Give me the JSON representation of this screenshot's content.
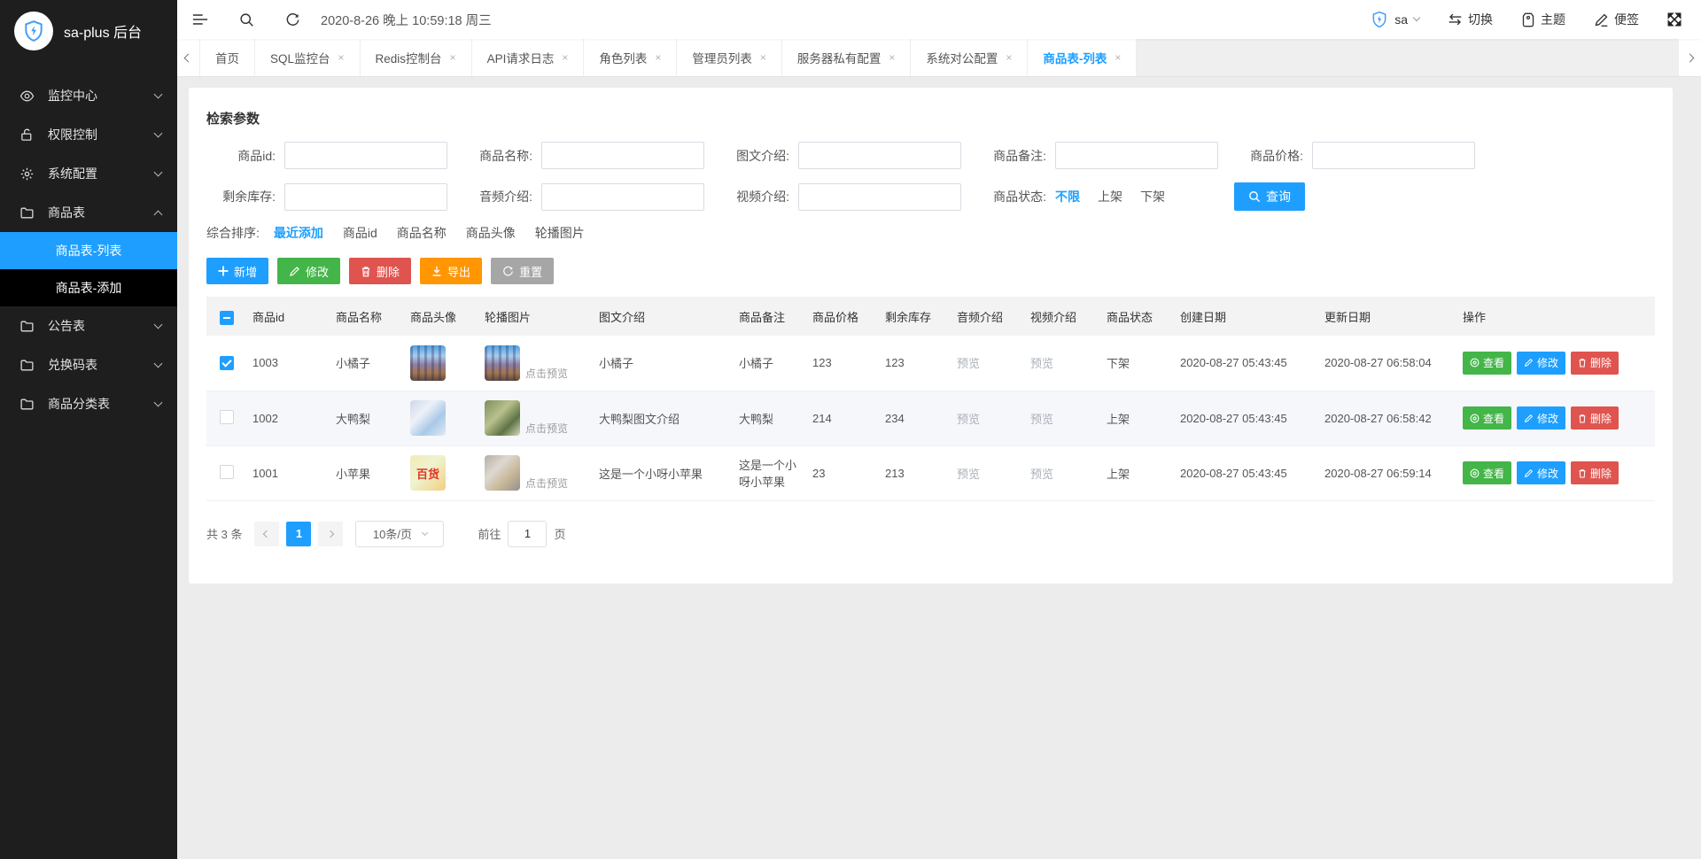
{
  "app_title": "sa-plus 后台",
  "topbar": {
    "time": "2020-8-26 晚上 10:59:18 周三",
    "username": "sa",
    "switch_label": "切换",
    "theme_label": "主题",
    "note_label": "便签"
  },
  "sidebar": {
    "items": [
      {
        "label": "监控中心",
        "icon": "eye-icon"
      },
      {
        "label": "权限控制",
        "icon": "unlock-icon"
      },
      {
        "label": "系统配置",
        "icon": "gear-icon"
      },
      {
        "label": "商品表",
        "icon": "folder-icon"
      },
      {
        "label": "公告表",
        "icon": "folder-icon"
      },
      {
        "label": "兑换码表",
        "icon": "folder-icon"
      },
      {
        "label": "商品分类表",
        "icon": "folder-icon"
      }
    ],
    "sub_items": [
      {
        "label": "商品表-列表",
        "active": true
      },
      {
        "label": "商品表-添加",
        "active": false
      }
    ]
  },
  "tabs": [
    {
      "label": "首页",
      "closable": false
    },
    {
      "label": "SQL监控台",
      "closable": true
    },
    {
      "label": "Redis控制台",
      "closable": true
    },
    {
      "label": "API请求日志",
      "closable": true
    },
    {
      "label": "角色列表",
      "closable": true
    },
    {
      "label": "管理员列表",
      "closable": true
    },
    {
      "label": "服务器私有配置",
      "closable": true
    },
    {
      "label": "系统对公配置",
      "closable": true
    },
    {
      "label": "商品表-列表",
      "closable": true,
      "active": true
    }
  ],
  "search": {
    "title": "检索参数",
    "fields": [
      {
        "label": "商品id:"
      },
      {
        "label": "商品名称:"
      },
      {
        "label": "图文介绍:"
      },
      {
        "label": "商品备注:"
      },
      {
        "label": "商品价格:"
      },
      {
        "label": "剩余库存:"
      },
      {
        "label": "音频介绍:"
      },
      {
        "label": "视频介绍:"
      }
    ],
    "status": {
      "label": "商品状态:",
      "options": [
        "不限",
        "上架",
        "下架"
      ],
      "active": "不限"
    },
    "query_label": "查询"
  },
  "sort": {
    "label": "综合排序:",
    "options": [
      "最近添加",
      "商品id",
      "商品名称",
      "商品头像",
      "轮播图片"
    ],
    "active": "最近添加"
  },
  "toolbar": {
    "add": "新增",
    "edit": "修改",
    "delete": "删除",
    "export": "导出",
    "reset": "重置"
  },
  "table": {
    "columns": [
      "商品id",
      "商品名称",
      "商品头像",
      "轮播图片",
      "图文介绍",
      "商品备注",
      "商品价格",
      "剩余库存",
      "音频介绍",
      "视频介绍",
      "商品状态",
      "创建日期",
      "更新日期",
      "操作"
    ],
    "preview_hint": "点击预览",
    "row_actions": {
      "view": "查看",
      "edit": "修改",
      "delete": "删除"
    },
    "rows": [
      {
        "selected": true,
        "id": "1003",
        "name": "小橘子",
        "avatar": "city-skyline-photo",
        "carousel": "city-skyline-photo",
        "intro": "小橘子",
        "note": "小橘子",
        "price": "123",
        "stock": "123",
        "audio": "预览",
        "video": "预览",
        "status": "下架",
        "created": "2020-08-27 05:43:45",
        "updated": "2020-08-27 06:58:04"
      },
      {
        "selected": false,
        "id": "1002",
        "name": "大鸭梨",
        "avatar": "pale-blue-photo",
        "carousel": "green-field-photo",
        "intro": "大鸭梨图文介绍",
        "note": "大鸭梨",
        "price": "214",
        "stock": "234",
        "audio": "预览",
        "video": "预览",
        "status": "上架",
        "created": "2020-08-27 05:43:45",
        "updated": "2020-08-27 06:58:42"
      },
      {
        "selected": false,
        "id": "1001",
        "name": "小苹果",
        "avatar": "store-sign-photo",
        "avatar_text": "百货",
        "carousel": "street-photo",
        "intro": "这是一个小呀小苹果",
        "note": "这是一个小呀小苹果",
        "price": "23",
        "stock": "213",
        "audio": "预览",
        "video": "预览",
        "status": "上架",
        "created": "2020-08-27 05:43:45",
        "updated": "2020-08-27 06:59:14"
      }
    ]
  },
  "pagination": {
    "total": "共 3 条",
    "current_page": "1",
    "page_size": "10条/页",
    "goto_label": "前往",
    "goto_value": "1",
    "unit_label": "页"
  },
  "colors": {
    "primary": "#1E9FFF",
    "success": "#44b549",
    "danger": "#df544e",
    "warning": "#ff9602",
    "neutral": "#a6a6a6",
    "sidebar_bg": "#1e1e1e",
    "page_bg": "#ececec"
  }
}
